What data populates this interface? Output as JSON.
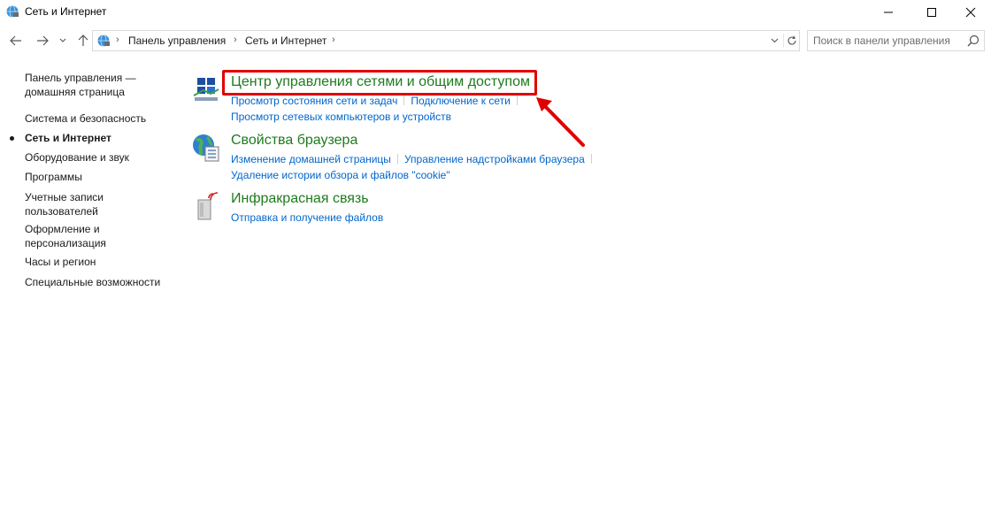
{
  "window": {
    "title": "Сеть и Интернет"
  },
  "breadcrumb": {
    "items": [
      "Панель управления",
      "Сеть и Интернет"
    ]
  },
  "search": {
    "placeholder": "Поиск в панели управления"
  },
  "sidebar": {
    "items": [
      {
        "label": "Панель управления — домашняя страница",
        "active": false
      },
      {
        "label": "Система и безопасность",
        "active": false
      },
      {
        "label": "Сеть и Интернет",
        "active": true
      },
      {
        "label": "Оборудование и звук",
        "active": false
      },
      {
        "label": "Программы",
        "active": false
      },
      {
        "label": "Учетные записи пользователей",
        "active": false
      },
      {
        "label": "Оформление и персонализация",
        "active": false
      },
      {
        "label": "Часы и регион",
        "active": false
      },
      {
        "label": "Специальные возможности",
        "active": false
      }
    ]
  },
  "categories": [
    {
      "title": "Центр управления сетями и общим доступом",
      "icon": "network-center-icon",
      "tasks": [
        [
          "Просмотр состояния сети и задач",
          "Подключение к сети"
        ],
        [
          "Просмотр сетевых компьютеров и устройств"
        ]
      ]
    },
    {
      "title": "Свойства браузера",
      "icon": "internet-options-icon",
      "tasks": [
        [
          "Изменение домашней страницы",
          "Управление надстройками браузера"
        ],
        [
          "Удаление истории обзора и файлов \"cookie\""
        ]
      ]
    },
    {
      "title": "Инфракрасная связь",
      "icon": "infrared-icon",
      "tasks": [
        [
          "Отправка и получение файлов"
        ]
      ]
    }
  ],
  "colors": {
    "category_title": "#1e7b1e",
    "link": "#0066cc",
    "highlight": "#e00000"
  }
}
